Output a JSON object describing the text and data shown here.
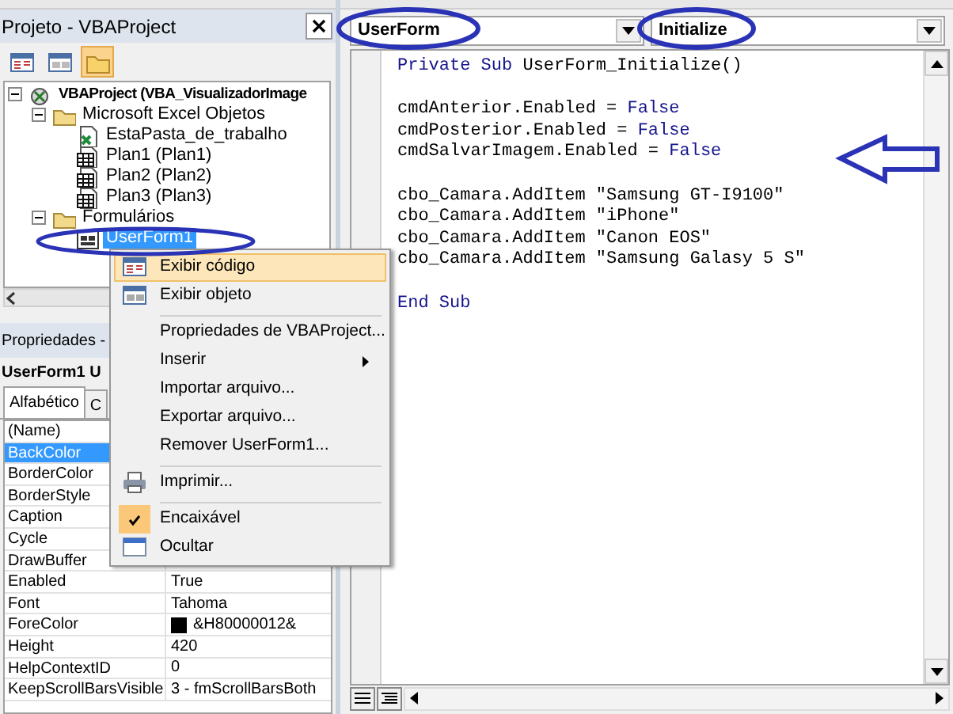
{
  "project_panel": {
    "title": "Projeto - VBAProject",
    "toolbar": [
      {
        "selected": false
      },
      {
        "selected": false
      },
      {
        "selected": true
      }
    ],
    "tree": [
      {
        "label": "VBAProject (VBA_VisualizadorImage",
        "kind": "project",
        "expanded": true,
        "selected": false,
        "children": [
          {
            "label": "Microsoft Excel Objetos",
            "kind": "folder",
            "expanded": true,
            "selected": false,
            "children": [
              {
                "label": "EstaPasta_de_trabalho",
                "kind": "workbook",
                "selected": false
              },
              {
                "label": "Plan1 (Plan1)",
                "kind": "sheet",
                "selected": false
              },
              {
                "label": "Plan2 (Plan2)",
                "kind": "sheet",
                "selected": false
              },
              {
                "label": "Plan3 (Plan3)",
                "kind": "sheet",
                "selected": false
              }
            ]
          },
          {
            "label": "Formulários",
            "kind": "folder",
            "expanded": true,
            "selected": false,
            "children": [
              {
                "label": "UserForm1",
                "kind": "form",
                "selected": true
              }
            ]
          }
        ]
      }
    ]
  },
  "properties_panel": {
    "title": "Propriedades -",
    "object": "UserForm1 U",
    "tabs": [
      {
        "label": "Alfabético",
        "selected": true
      },
      {
        "label": "C",
        "selected": false
      }
    ],
    "rows": [
      {
        "name": "(Name)",
        "selected": false
      },
      {
        "name": "BackColor",
        "selected": true
      },
      {
        "name": "BorderColor",
        "selected": false
      },
      {
        "name": "BorderStyle",
        "selected": false
      },
      {
        "name": "Caption",
        "selected": false
      },
      {
        "name": "Cycle",
        "selected": false
      },
      {
        "name": "DrawBuffer",
        "selected": false
      },
      {
        "name": "Enabled",
        "value": "True",
        "selected": false
      },
      {
        "name": "Font",
        "value": "Tahoma",
        "selected": false
      },
      {
        "name": "ForeColor",
        "value": "&H80000012&",
        "color": "#000000",
        "selected": false
      },
      {
        "name": "Height",
        "value": "420",
        "selected": false
      },
      {
        "name": "HelpContextID",
        "value": "0",
        "selected": false
      },
      {
        "name": "KeepScrollBarsVisible",
        "value": "3 - fmScrollBarsBoth",
        "selected": false
      }
    ]
  },
  "code_window": {
    "object": "UserForm",
    "procedure": "Initialize",
    "lines": [
      {
        "kind": "code",
        "tokens": [
          {
            "text": "Private Sub",
            "kind": "keyword"
          },
          {
            "text": " UserForm_Initialize()",
            "kind": "plain"
          }
        ]
      },
      {
        "kind": "blank"
      },
      {
        "kind": "code",
        "tokens": [
          {
            "text": "cmdAnterior.Enabled = ",
            "kind": "plain"
          },
          {
            "text": "False",
            "kind": "keyword"
          }
        ]
      },
      {
        "kind": "code",
        "tokens": [
          {
            "text": "cmdPosterior.Enabled = ",
            "kind": "plain"
          },
          {
            "text": "False",
            "kind": "keyword"
          }
        ]
      },
      {
        "kind": "code",
        "tokens": [
          {
            "text": "cmdSalvarImagem.Enabled = ",
            "kind": "plain"
          },
          {
            "text": "False",
            "kind": "keyword"
          }
        ]
      },
      {
        "kind": "blank"
      },
      {
        "kind": "code",
        "tokens": [
          {
            "text": "cbo_Camara.AddItem \"Samsung GT-I9100\"",
            "kind": "plain"
          }
        ]
      },
      {
        "kind": "code",
        "tokens": [
          {
            "text": "cbo_Camara.AddItem \"iPhone\"",
            "kind": "plain"
          }
        ]
      },
      {
        "kind": "code",
        "tokens": [
          {
            "text": "cbo_Camara.AddItem \"Canon EOS\"",
            "kind": "plain"
          }
        ]
      },
      {
        "kind": "code",
        "tokens": [
          {
            "text": "cbo_Camara.AddItem \"Samsung Galasy 5 S\"",
            "kind": "plain"
          }
        ]
      },
      {
        "kind": "blank"
      },
      {
        "kind": "code",
        "tokens": [
          {
            "text": "End Sub",
            "kind": "keyword"
          }
        ]
      }
    ]
  },
  "context_menu": {
    "items": [
      {
        "label": "Exibir código",
        "selected": true,
        "checked": false,
        "submenu": false,
        "separator_before": false
      },
      {
        "label": "Exibir objeto",
        "selected": false,
        "checked": false,
        "submenu": false,
        "separator_before": false
      },
      {
        "label": "Propriedades de VBAProject...",
        "selected": false,
        "checked": false,
        "submenu": false,
        "separator_before": true
      },
      {
        "label": "Inserir",
        "selected": false,
        "checked": false,
        "submenu": true,
        "separator_before": false
      },
      {
        "label": "Importar arquivo...",
        "selected": false,
        "checked": false,
        "submenu": false,
        "separator_before": false
      },
      {
        "label": "Exportar arquivo...",
        "selected": false,
        "checked": false,
        "submenu": false,
        "separator_before": false
      },
      {
        "label": "Remover UserForm1...",
        "selected": false,
        "checked": false,
        "submenu": false,
        "separator_before": false
      },
      {
        "label": "Imprimir...",
        "selected": false,
        "checked": false,
        "submenu": false,
        "separator_before": true
      },
      {
        "label": "Encaixável",
        "selected": false,
        "checked": true,
        "submenu": false,
        "separator_before": true
      },
      {
        "label": "Ocultar",
        "selected": false,
        "checked": false,
        "submenu": false,
        "separator_before": false
      }
    ]
  }
}
